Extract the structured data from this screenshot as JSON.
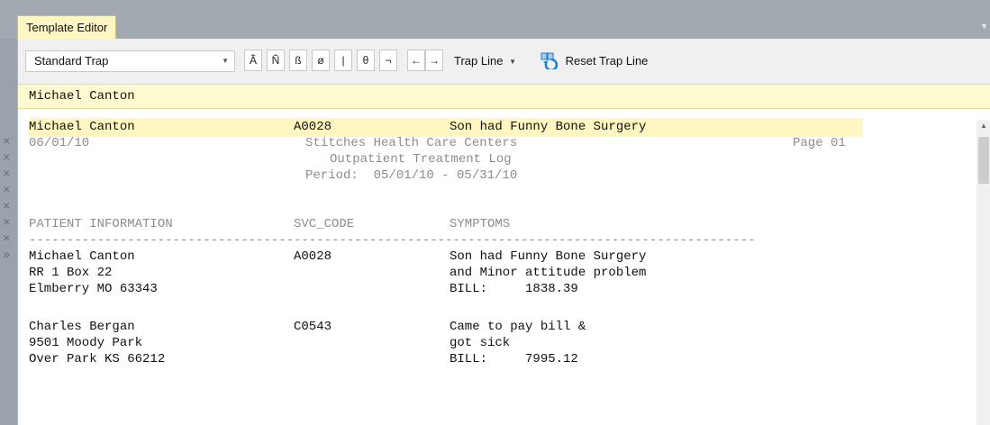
{
  "window": {
    "tab_title": "Template Editor",
    "tab_menu_icon": "chevron-down-icon"
  },
  "toolbar": {
    "trap_type": "Standard Trap",
    "special_chars": [
      "Ã",
      "Ñ",
      "ß",
      "ø",
      "|",
      "θ",
      "¬"
    ],
    "left_arrow": "←",
    "right_arrow": "→",
    "trap_line_label": "Trap Line",
    "reset_trap_line_label": "Reset Trap Line"
  },
  "trap_field": {
    "value": "Michael Canton"
  },
  "trap_row": {
    "name": "Michael Canton",
    "code": "A0028",
    "symptom": "Son had Funny Bone Surgery"
  },
  "report": {
    "date": "06/01/10",
    "company": "Stitches Health Care Centers",
    "page": "Page 01",
    "title": "Outpatient Treatment Log",
    "period": "Period:  05/01/10 - 05/31/10",
    "col_patient": "PATIENT INFORMATION",
    "col_code": "SVC_CODE",
    "col_symptoms": "SYMPTOMS",
    "divider": "------------------------------------------------------------------------------------------------",
    "records": [
      {
        "name": "Michael Canton",
        "code": "A0028",
        "address1": "RR 1 Box 22",
        "address2": "Elmberry MO 63343",
        "symptom1": "Son had Funny Bone Surgery",
        "symptom2": "and Minor attitude problem",
        "bill": "BILL:     1838.39"
      },
      {
        "name": "Charles Bergan",
        "code": "C0543",
        "address1": "9501 Moody Park",
        "address2": "Over Park KS 66212",
        "symptom1": "Came to pay bill &",
        "symptom2": "got sick",
        "bill": "BILL:     7995.12"
      }
    ]
  },
  "gutter": {
    "exclude_marker": "×",
    "current_marker": "»"
  },
  "colors": {
    "tab_yellow": "#fff6c2",
    "trap_field_yellow": "#fffbd1",
    "reset_icon_blue": "#1a7bd0"
  }
}
